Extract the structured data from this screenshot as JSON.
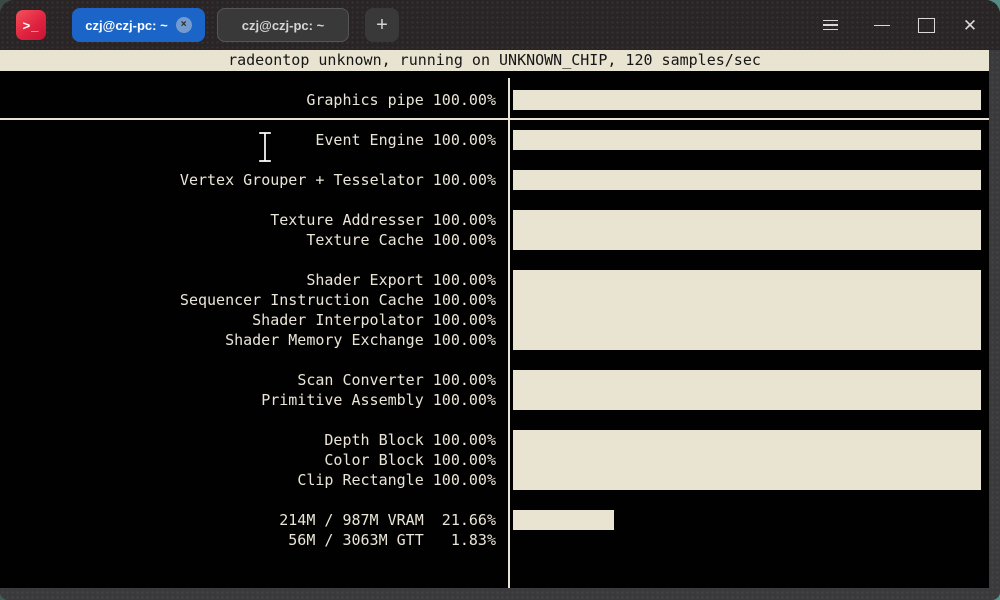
{
  "titlebar": {
    "app_icon_glyph": ">_",
    "tabs": [
      {
        "label": "czj@czj-pc: ~",
        "active": true,
        "close_glyph": "×"
      },
      {
        "label": "czj@czj-pc: ~",
        "active": false
      }
    ],
    "new_tab_glyph": "+",
    "controls": {
      "close_glyph": "✕"
    }
  },
  "terminal": {
    "header": "radeontop unknown, running on UNKNOWN_CHIP, 120 samples/sec",
    "colors": {
      "background": "#010101",
      "foreground": "#eae5d6",
      "bar_fill": "#e9e3d1",
      "header_bg": "#e9e3d1",
      "header_fg": "#161616",
      "active_tab": "#1b65c8",
      "app_icon": "#e02340"
    },
    "metrics": [
      {
        "row": 2,
        "label": "Graphics pipe",
        "value": "100.00%",
        "bar_pct": 100
      },
      {
        "row": 4,
        "label": "Event Engine",
        "value": "100.00%",
        "bar_pct": 100
      },
      {
        "row": 6,
        "label": "Vertex Grouper + Tesselator",
        "value": "100.00%",
        "bar_pct": 100
      },
      {
        "row": 8,
        "label": "Texture Addresser",
        "value": "100.00%",
        "bar_pct": 100
      },
      {
        "row": 9,
        "label": "Texture Cache",
        "value": "100.00%",
        "bar_pct": 100
      },
      {
        "row": 11,
        "label": "Shader Export",
        "value": "100.00%",
        "bar_pct": 100
      },
      {
        "row": 12,
        "label": "Sequencer Instruction Cache",
        "value": "100.00%",
        "bar_pct": 100
      },
      {
        "row": 13,
        "label": "Shader Interpolator",
        "value": "100.00%",
        "bar_pct": 100
      },
      {
        "row": 14,
        "label": "Shader Memory Exchange",
        "value": "100.00%",
        "bar_pct": 100
      },
      {
        "row": 16,
        "label": "Scan Converter",
        "value": "100.00%",
        "bar_pct": 100
      },
      {
        "row": 17,
        "label": "Primitive Assembly",
        "value": "100.00%",
        "bar_pct": 100
      },
      {
        "row": 19,
        "label": "Depth Block",
        "value": "100.00%",
        "bar_pct": 100
      },
      {
        "row": 20,
        "label": "Color Block",
        "value": "100.00%",
        "bar_pct": 100
      },
      {
        "row": 21,
        "label": "Clip Rectangle",
        "value": "100.00%",
        "bar_pct": 100
      },
      {
        "row": 23,
        "label": "214M / 987M VRAM",
        "value": "21.66%",
        "bar_pct": 21.66
      },
      {
        "row": 24,
        "label": "56M / 3063M GTT",
        "value": "1.83%",
        "bar_pct": 0
      }
    ]
  }
}
